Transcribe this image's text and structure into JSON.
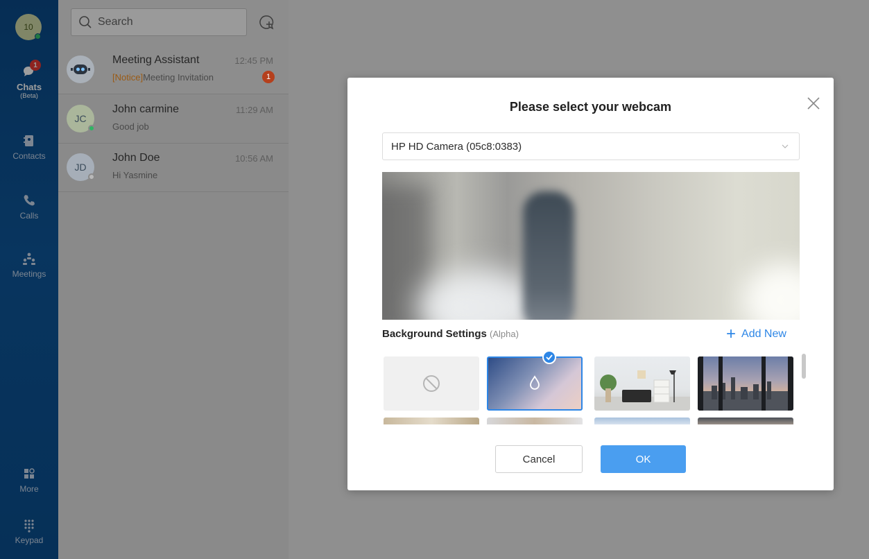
{
  "user": {
    "initials": "10",
    "status_color": "#36c26b"
  },
  "nav": {
    "chats": {
      "label": "Chats",
      "sub": "(Beta)",
      "badge": "1"
    },
    "contacts": {
      "label": "Contacts"
    },
    "calls": {
      "label": "Calls"
    },
    "meetings": {
      "label": "Meetings"
    },
    "more": {
      "label": "More"
    },
    "keypad": {
      "label": "Keypad"
    }
  },
  "search": {
    "placeholder": "Search"
  },
  "chats": [
    {
      "name": "Meeting Assistant",
      "time": "12:45 PM",
      "notice": "[Notice]",
      "message": "Meeting Invitation",
      "unread": "1",
      "avatar": "robot-icon"
    },
    {
      "name": "John carmine",
      "time": "11:29 AM",
      "message": "Good job",
      "initials": "JC",
      "status": "online"
    },
    {
      "name": "John Doe",
      "time": "10:56 AM",
      "message": "Hi Yasmine",
      "initials": "JD",
      "status": "offline"
    }
  ],
  "dialog": {
    "title": "Please select your webcam",
    "camera_selected": "HP HD Camera (05c8:0383)",
    "background": {
      "title": "Background Settings",
      "tag": "(Alpha)",
      "add_new": "Add New"
    },
    "cancel": "Cancel",
    "ok": "OK"
  },
  "colors": {
    "accent": "#2d86e6",
    "ok_button": "#4a9ef0",
    "badge": "#e53935"
  }
}
